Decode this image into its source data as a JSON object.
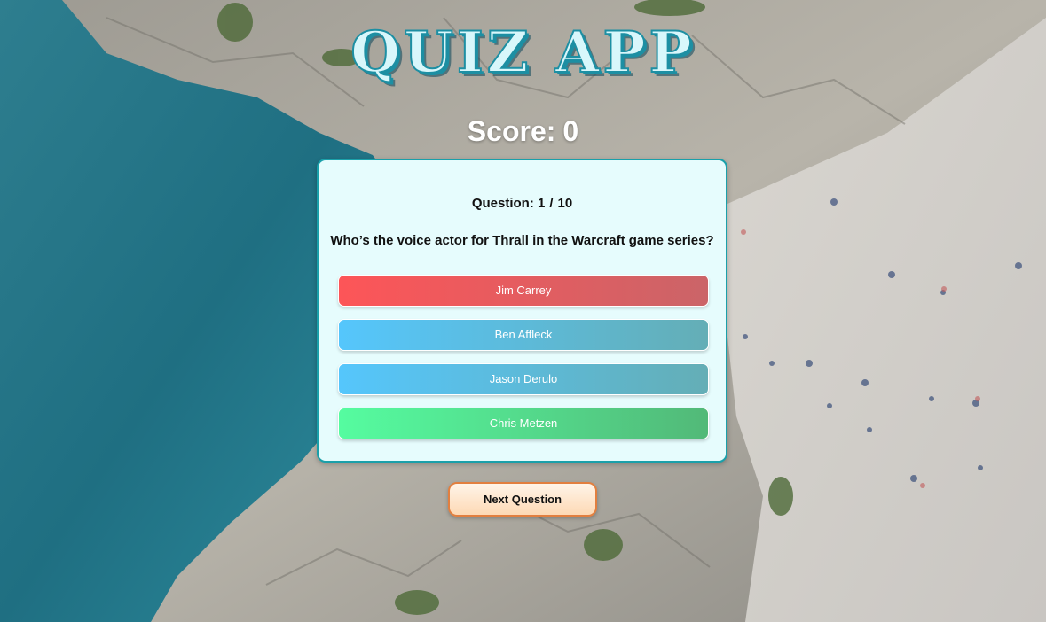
{
  "app": {
    "title": "QUIZ APP",
    "score_label": "Score:",
    "score_value": "0"
  },
  "quiz": {
    "question_label": "Question:",
    "current": "1",
    "separator": "/",
    "total": "10",
    "question_text": "Who’s the voice actor for Thrall in the Warcraft game series?",
    "answers": [
      {
        "label": "Jim Carrey",
        "state": "incorrect"
      },
      {
        "label": "Ben Affleck",
        "state": "neutral"
      },
      {
        "label": "Jason Derulo",
        "state": "neutral"
      },
      {
        "label": "Chris Metzen",
        "state": "correct"
      }
    ]
  },
  "controls": {
    "next_label": "Next Question"
  },
  "colors": {
    "incorrect": "#fd5558",
    "neutral": "#55c6fc",
    "correct": "#55fca0",
    "card_border": "#1aa0aa",
    "next_border": "#e27f3f"
  }
}
